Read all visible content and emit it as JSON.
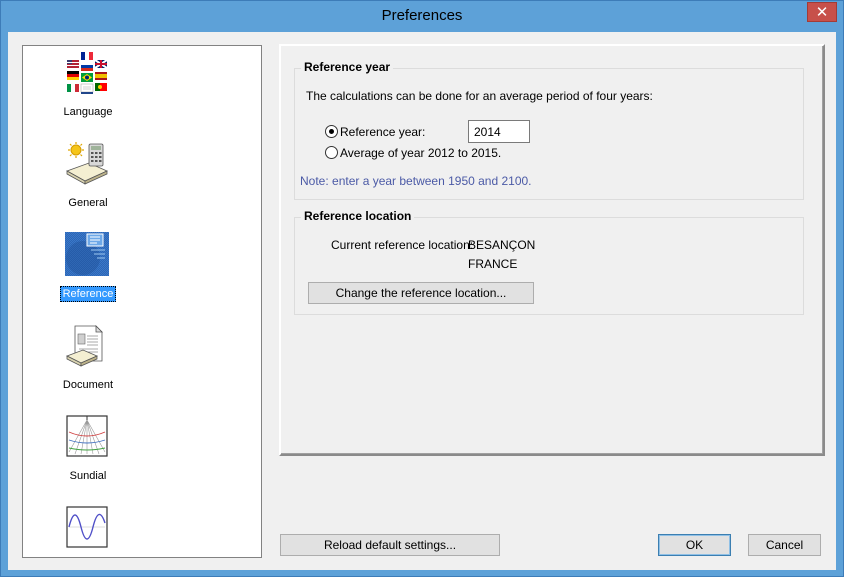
{
  "window": {
    "title": "Preferences",
    "close_symbol": "✕"
  },
  "sidebar": {
    "items": [
      {
        "label": "Language",
        "icon": "flags-icon"
      },
      {
        "label": "General",
        "icon": "calculator-sun-icon"
      },
      {
        "label": "Reference",
        "icon": "globe-icon",
        "selected": true
      },
      {
        "label": "Document",
        "icon": "document-icon"
      },
      {
        "label": "Sundial",
        "icon": "sundial-icon"
      },
      {
        "label": "",
        "icon": "waveform-icon"
      }
    ]
  },
  "reference_year": {
    "title": "Reference year",
    "description": "The calculations can be done for an average period of four years:",
    "option_year_label": "Reference year:",
    "year_value": "2014",
    "option_average_label": "Average of year 2012 to 2015.",
    "note": "Note: enter a year between 1950 and 2100."
  },
  "reference_location": {
    "title": "Reference location",
    "current_label": "Current reference location:",
    "city": "BESANÇON",
    "country": "FRANCE",
    "change_button": "Change the reference location..."
  },
  "footer": {
    "reload_button": "Reload default settings...",
    "ok_button": "OK",
    "cancel_button": "Cancel"
  },
  "colors": {
    "accent": "#5da1d8",
    "selection": "#3399ff",
    "note": "#4b5aa6"
  }
}
